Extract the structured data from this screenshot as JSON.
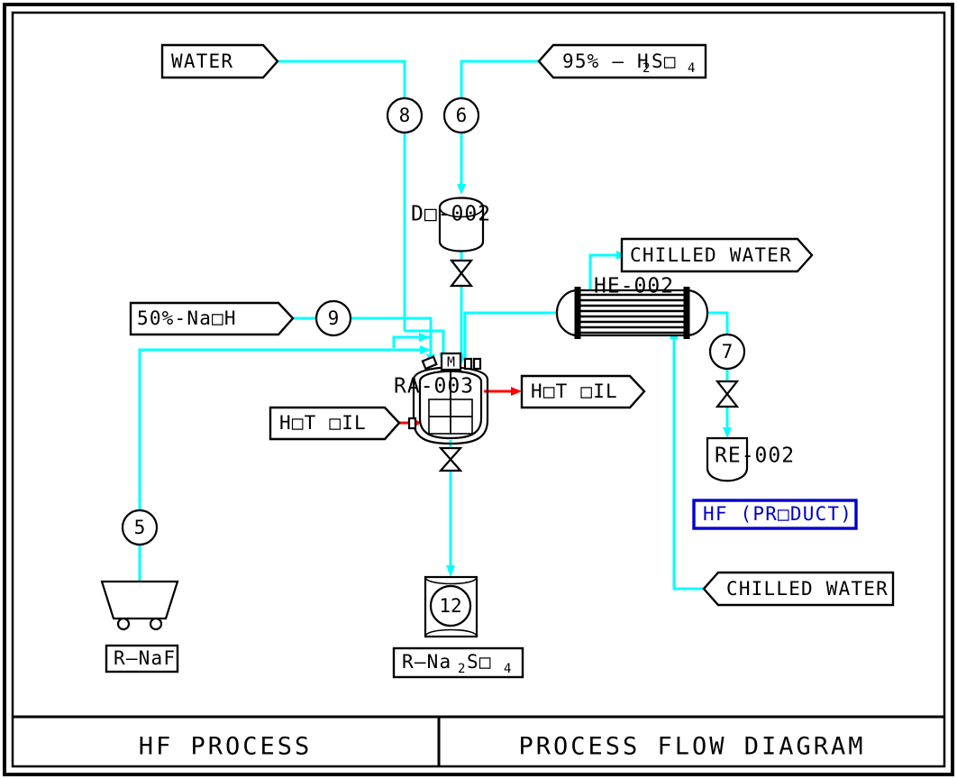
{
  "drawing": {
    "type": "Process Flow Diagram",
    "title_block": {
      "left_cell": "HF PROCESS",
      "right_cell": "PROCESS FLOW DIAGRAM"
    },
    "colors": {
      "process_line": "#00ffff",
      "hot_oil_line": "#ff0000",
      "product_highlight": "#0000cc",
      "equipment_outline": "#000000",
      "background": "#ffffff"
    }
  },
  "stream_labels": [
    {
      "id": "water-in",
      "text": "WATER",
      "style": "arrow-right"
    },
    {
      "id": "sulfuric-acid-in",
      "text": "95% - H2SO4",
      "style": "arrow-left",
      "rich": [
        "95% – H",
        "2",
        "S□",
        "4"
      ]
    },
    {
      "id": "naoh-in",
      "text": "50%-NaOH",
      "style": "arrow-right"
    },
    {
      "id": "hot-oil-in",
      "text": "HOT OIL",
      "style": "arrow-right"
    },
    {
      "id": "hot-oil-out",
      "text": "HOT OIL",
      "style": "arrow-right"
    },
    {
      "id": "chilled-water-out",
      "text": "CHILLED WATER",
      "style": "arrow-right"
    },
    {
      "id": "chilled-water-in",
      "text": "CHILLED WATER",
      "style": "arrow-left"
    }
  ],
  "labels": {
    "water": "WATER",
    "sulfuric_acid": "95% - H□",
    "sulfuric_prefix": "95% – H",
    "sulfuric_sub1": "2",
    "sulfuric_mid": "S□",
    "sulfuric_sub2": "4",
    "naoh": "50%-Na□H",
    "hot_oil_in": "H□T  □IL",
    "hot_oil_out": "H□T  □IL",
    "chilled_water_out": "CHILLED  WATER",
    "chilled_water_in": "CHILLED  WATER",
    "product": "HF  (PR□DUCT)",
    "r_naf": "R–NaF",
    "r_na2so4_prefix": "R–Na",
    "r_na2so4_sub1": "2",
    "r_na2so4_mid": "S□",
    "r_na2so4_sub2": "4"
  },
  "equipment": [
    {
      "tag": "D□-002",
      "name": "acid-day-tank",
      "type": "vertical-vessel"
    },
    {
      "tag": "RA-003",
      "name": "reactor",
      "type": "jacketed-agitated-reactor",
      "driver": "M"
    },
    {
      "tag": "HE-002",
      "name": "heat-exchanger",
      "type": "shell-and-tube"
    },
    {
      "tag": "RE-002",
      "name": "product-receiver",
      "type": "vertical-vessel"
    }
  ],
  "equipment_tags": {
    "do_002": "D□-002",
    "ra_003": "RA-003",
    "he_002": "HE-002",
    "re_002": "RE-002",
    "motor": "M"
  },
  "stream_numbers": [
    {
      "number": "5",
      "name": "stream-5-naf-slurry"
    },
    {
      "number": "6",
      "name": "stream-6-sulfuric-acid"
    },
    {
      "number": "7",
      "name": "stream-7-hf-product"
    },
    {
      "number": "8",
      "name": "stream-8-water"
    },
    {
      "number": "9",
      "name": "stream-9-caustic"
    },
    {
      "number": "12",
      "name": "stream-12-sodium-sulfate"
    }
  ],
  "balloons": {
    "s5": "5",
    "s6": "6",
    "s7": "7",
    "s8": "8",
    "s9": "9",
    "s12": "12"
  },
  "valves": [
    {
      "name": "valve-below-do-002",
      "type": "manual-gate"
    },
    {
      "name": "valve-below-ra-003",
      "type": "manual-gate"
    },
    {
      "name": "valve-below-stream-7",
      "type": "manual-gate"
    }
  ]
}
